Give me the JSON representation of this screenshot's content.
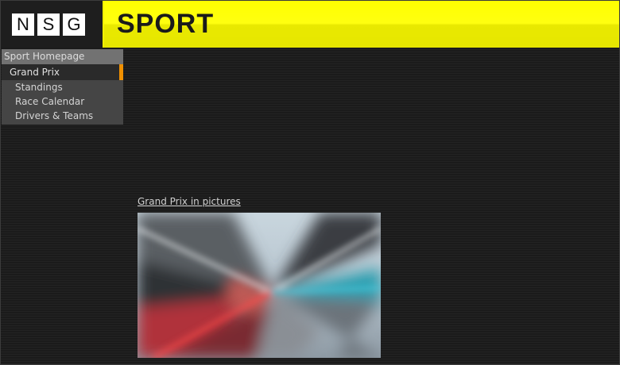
{
  "header": {
    "logo_letters": [
      "N",
      "S",
      "G"
    ],
    "title": "SPORT",
    "brand_color": "#ffff00"
  },
  "sidebar": {
    "home_label": "Sport Homepage",
    "section_label": "Grand Prix",
    "accent_color": "#f09000",
    "items": [
      {
        "label": "Standings"
      },
      {
        "label": "Race Calendar"
      },
      {
        "label": "Drivers & Teams"
      }
    ]
  },
  "main": {
    "pictures_link": "Grand Prix in pictures",
    "photo_icon": "motion-blur-race-car-photo"
  }
}
